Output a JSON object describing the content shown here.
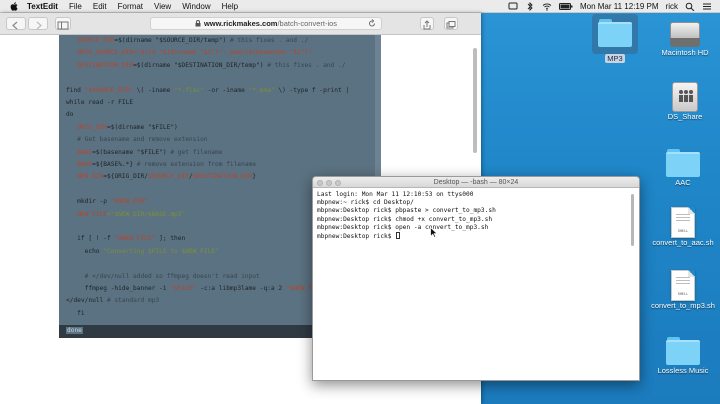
{
  "menubar": {
    "items": [
      "TextEdit",
      "File",
      "Edit",
      "Format",
      "View",
      "Window",
      "Help"
    ],
    "clock": "Mon Mar 11  12:19 PM",
    "user": "rick"
  },
  "browser": {
    "url_host": "www.rickmakes.com",
    "url_path": "/batch-convert-ios",
    "code_lines": [
      [
        {
          "t": "   ",
          "c": "k"
        },
        {
          "t": "SOURCE_DIR",
          "c": "v"
        },
        {
          "t": "=$(dirname \"$SOURCE_DIR/temp\")",
          "c": "k"
        },
        {
          "t": " # this fixes . and ./",
          "c": "c"
        }
      ],
      [
        {
          "t": "   ",
          "c": "k"
        },
        {
          "t": "ORIG_SOURCE_DIR",
          "c": "v"
        },
        {
          "t": "=\"$(cd \"$(dirname \"$1\")\"; pwd)/$(basename \"$1\")\"",
          "c": "v"
        }
      ],
      [
        {
          "t": "   ",
          "c": "k"
        },
        {
          "t": "DESTINATION_DIR",
          "c": "v"
        },
        {
          "t": "=$(dirname \"$DESTINATION_DIR/temp\")",
          "c": "k"
        },
        {
          "t": " # this fixes . and ./",
          "c": "c"
        }
      ],
      [
        {
          "t": "",
          "c": "k"
        }
      ],
      [
        {
          "t": "find ",
          "c": "k"
        },
        {
          "t": "\"$SOURCE_DIR\"",
          "c": "v"
        },
        {
          "t": " \\( -iname ",
          "c": "k"
        },
        {
          "t": "\"*.flac\"",
          "c": "s"
        },
        {
          "t": " -or -iname ",
          "c": "k"
        },
        {
          "t": "\"*.m4a\"",
          "c": "s"
        },
        {
          "t": " \\) -type f -print |",
          "c": "k"
        }
      ],
      [
        {
          "t": "while read -r FILE",
          "c": "k"
        }
      ],
      [
        {
          "t": "do",
          "c": "k"
        }
      ],
      [
        {
          "t": "   ",
          "c": "k"
        },
        {
          "t": "ORIG_DIR",
          "c": "v"
        },
        {
          "t": "=$(dirname \"$FILE\")",
          "c": "k"
        }
      ],
      [
        {
          "t": "   # Get basename and remove extension",
          "c": "c"
        }
      ],
      [
        {
          "t": "   ",
          "c": "k"
        },
        {
          "t": "BASE",
          "c": "v"
        },
        {
          "t": "=$(basename \"$FILE\")",
          "c": "k"
        },
        {
          "t": " # get filename",
          "c": "c"
        }
      ],
      [
        {
          "t": "   ",
          "c": "k"
        },
        {
          "t": "BASE",
          "c": "v"
        },
        {
          "t": "=${BASE%.*}",
          "c": "k"
        },
        {
          "t": " # remove extension from filename",
          "c": "c"
        }
      ],
      [
        {
          "t": "   ",
          "c": "k"
        },
        {
          "t": "NEW_DIR",
          "c": "v"
        },
        {
          "t": "=${ORIG_DIR/",
          "c": "k"
        },
        {
          "t": "$SOURCE_DIR",
          "c": "v"
        },
        {
          "t": "/",
          "c": "k"
        },
        {
          "t": "$DESTINATION_DIR",
          "c": "v"
        },
        {
          "t": "}",
          "c": "k"
        }
      ],
      [
        {
          "t": "",
          "c": "k"
        }
      ],
      [
        {
          "t": "   mkdir -p ",
          "c": "k"
        },
        {
          "t": "\"$NEW_DIR\"",
          "c": "v"
        }
      ],
      [
        {
          "t": "   ",
          "c": "k"
        },
        {
          "t": "NEW_FILE",
          "c": "v"
        },
        {
          "t": "=\"$NEW_DIR/$BASE.mp3\"",
          "c": "s"
        }
      ],
      [
        {
          "t": "",
          "c": "k"
        }
      ],
      [
        {
          "t": "   if [ ! -f ",
          "c": "k"
        },
        {
          "t": "\"$NEW_FILE\"",
          "c": "v"
        },
        {
          "t": " ]; then",
          "c": "k"
        }
      ],
      [
        {
          "t": "     echo ",
          "c": "k"
        },
        {
          "t": "\"Converting $FILE to $NEW_FILE\"",
          "c": "s"
        }
      ],
      [
        {
          "t": "",
          "c": "k"
        }
      ],
      [
        {
          "t": "     # </dev/null added so ffmpeg doesn't read input",
          "c": "c"
        }
      ],
      [
        {
          "t": "     ffmpeg -hide_banner -i ",
          "c": "k"
        },
        {
          "t": "\"$FILE\"",
          "c": "v"
        },
        {
          "t": " -c:a libmp3lame -q:a 2 ",
          "c": "k"
        },
        {
          "t": "\"$NEW_FILE\"",
          "c": "v"
        }
      ],
      [
        {
          "t": "</dev/null",
          "c": "k"
        },
        {
          "t": " # standard mp3",
          "c": "c"
        }
      ],
      [
        {
          "t": "   fi",
          "c": "k"
        }
      ]
    ],
    "code_last": "done"
  },
  "terminal": {
    "title": "Desktop — -bash — 80×24",
    "lines": [
      "Last login: Mon Mar 11 12:10:53 on ttys000",
      "mbpnew:~ rick$ cd Desktop/",
      "mbpnew:Desktop rick$ pbpaste > convert_to_mp3.sh",
      "mbpnew:Desktop rick$ chmod +x convert_to_mp3.sh",
      "mbpnew:Desktop rick$ open -a convert_to_mp3.sh",
      "mbpnew:Desktop rick$ "
    ]
  },
  "desktop": {
    "icons": [
      {
        "label": "MP3",
        "kind": "folder",
        "selected": true
      },
      {
        "label": "Macintosh HD",
        "kind": "disk"
      },
      {
        "label": "DS_Share",
        "kind": "share"
      },
      {
        "label": "AAC",
        "kind": "folder"
      },
      {
        "label": "convert_to_aac.sh",
        "kind": "script",
        "tag": "SHELL"
      },
      {
        "label": "convert_to_mp3.sh",
        "kind": "script",
        "tag": "SHELL"
      },
      {
        "label": "Lossless Music",
        "kind": "folder"
      }
    ]
  }
}
